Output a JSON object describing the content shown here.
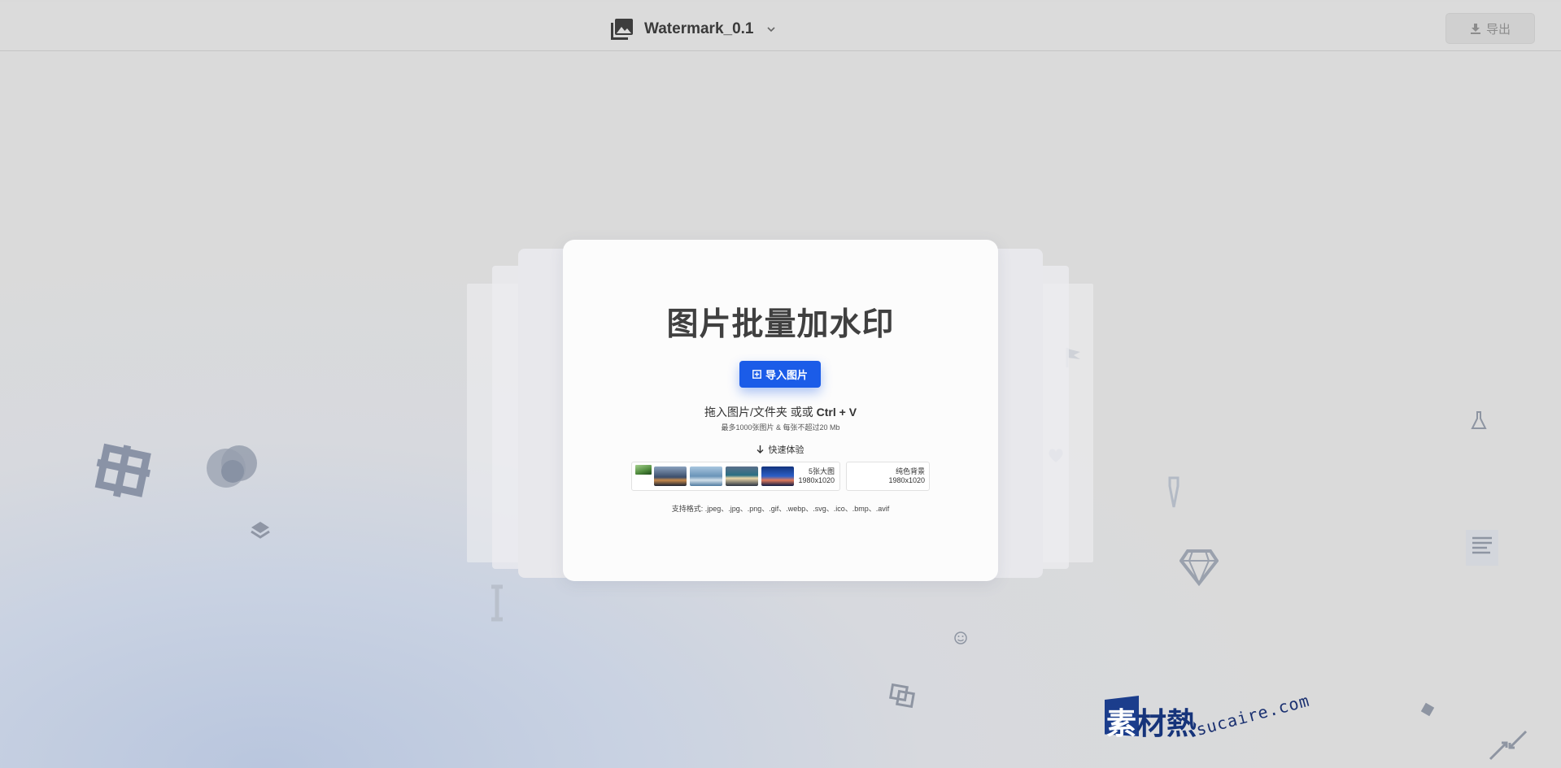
{
  "header": {
    "project_name": "Watermark_0.1",
    "export_label": "导出"
  },
  "card": {
    "title": "图片批量加水印",
    "import_button": "导入图片",
    "drop_hint": "拖入图片/文件夹 或或",
    "shortcut": "Ctrl + V",
    "limit": "最多1000张图片 & 每张不超过20 Mb",
    "quick_title": "快速体验",
    "samples": {
      "label_line1": "5张大图",
      "label_line2": "1980x1020"
    },
    "solid": {
      "label_line1": "纯色背景",
      "label_line2": "1980x1020"
    },
    "formats": "支持格式: .jpeg、.jpg、.png、.gif、.webp、.svg、.ico、.bmp、.avif"
  },
  "watermark": {
    "cn": "素材熱",
    "cn_first": "素",
    "cn_rest": "材熱",
    "en": "sucaire.com"
  },
  "colors": {
    "accent": "#1b5ce8",
    "watermark_blue": "#1b3d8c"
  },
  "icons": [
    "image-icon",
    "chevron-down-icon",
    "download-icon",
    "add-square-icon",
    "arrow-down-icon"
  ]
}
